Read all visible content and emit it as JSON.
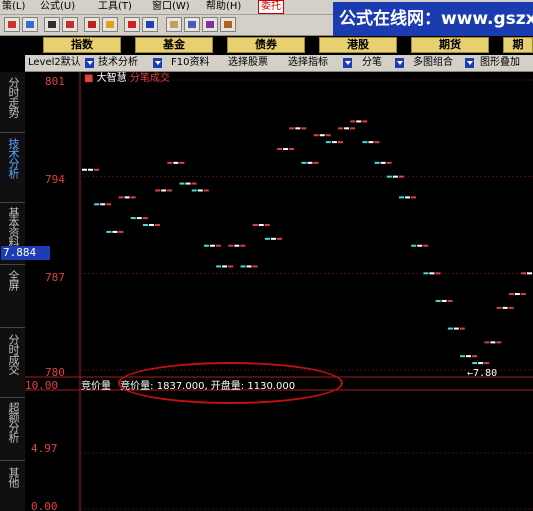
{
  "menu": {
    "items": [
      {
        "label": "策(L)"
      },
      {
        "label": "公式(U)"
      },
      {
        "label": "工具(T)"
      },
      {
        "label": "窗口(W)"
      },
      {
        "label": "帮助(H)"
      },
      {
        "label": "委托"
      }
    ]
  },
  "watermark": {
    "text": "公式在线网：www.gszx.com.cn"
  },
  "categories": [
    {
      "label": "指数"
    },
    {
      "label": "基金"
    },
    {
      "label": "债券"
    },
    {
      "label": "港股"
    },
    {
      "label": "期货"
    },
    {
      "label": "期"
    }
  ],
  "funcbar": {
    "items": [
      {
        "label": "Level2默认"
      },
      {
        "label": "技术分析"
      },
      {
        "label": "F10资料"
      },
      {
        "label": "选择股票"
      },
      {
        "label": "选择指标"
      },
      {
        "label": "分笔"
      },
      {
        "label": "多图组合"
      },
      {
        "label": "图形叠加"
      }
    ]
  },
  "leftnav": {
    "tabs": [
      {
        "label": "分时走势"
      },
      {
        "label": "技术分析"
      },
      {
        "label": "基本资料"
      },
      {
        "label": "全屏"
      },
      {
        "label": "分时成交"
      },
      {
        "label": "超额分析"
      },
      {
        "label": "其他"
      }
    ]
  },
  "stock": {
    "name": "大智慧",
    "subtitle": "分笔成交"
  },
  "price_axis": {
    "labels": [
      "801",
      "794",
      "787",
      "780"
    ],
    "current": "7.884",
    "marker": "7.80"
  },
  "volume_axis": {
    "labels": [
      "10.00",
      "4.97",
      "0.00"
    ]
  },
  "auction": {
    "label": "竞价量",
    "detail": "竞价量: 1837.000, 开盘量: 1130.000"
  },
  "colors": {
    "up": "#e04040",
    "down": "#40e0e0",
    "neutral": "#ffffff",
    "accent": "#1e3cb4"
  },
  "chart_data": {
    "type": "scatter",
    "title": "",
    "ylabel": "",
    "ylim": [
      780,
      801
    ],
    "points": [
      {
        "x": 1,
        "y": 794.5
      },
      {
        "x": 3,
        "y": 792
      },
      {
        "x": 5,
        "y": 790
      },
      {
        "x": 7,
        "y": 792.5
      },
      {
        "x": 9,
        "y": 791
      },
      {
        "x": 11,
        "y": 790.5
      },
      {
        "x": 13,
        "y": 793
      },
      {
        "x": 15,
        "y": 795
      },
      {
        "x": 17,
        "y": 793.5
      },
      {
        "x": 19,
        "y": 793
      },
      {
        "x": 21,
        "y": 789
      },
      {
        "x": 23,
        "y": 787.5
      },
      {
        "x": 25,
        "y": 789
      },
      {
        "x": 27,
        "y": 787.5
      },
      {
        "x": 29,
        "y": 790.5
      },
      {
        "x": 31,
        "y": 789.5
      },
      {
        "x": 33,
        "y": 796
      },
      {
        "x": 35,
        "y": 797.5
      },
      {
        "x": 37,
        "y": 795
      },
      {
        "x": 39,
        "y": 797
      },
      {
        "x": 41,
        "y": 796.5
      },
      {
        "x": 43,
        "y": 797.5
      },
      {
        "x": 45,
        "y": 798
      },
      {
        "x": 47,
        "y": 796.5
      },
      {
        "x": 49,
        "y": 795
      },
      {
        "x": 51,
        "y": 794
      },
      {
        "x": 53,
        "y": 792.5
      },
      {
        "x": 55,
        "y": 789
      },
      {
        "x": 57,
        "y": 787
      },
      {
        "x": 59,
        "y": 785
      },
      {
        "x": 61,
        "y": 783
      },
      {
        "x": 63,
        "y": 781
      },
      {
        "x": 65,
        "y": 780.5
      },
      {
        "x": 67,
        "y": 782
      },
      {
        "x": 69,
        "y": 784.5
      },
      {
        "x": 71,
        "y": 785.5
      },
      {
        "x": 73,
        "y": 787
      }
    ]
  }
}
